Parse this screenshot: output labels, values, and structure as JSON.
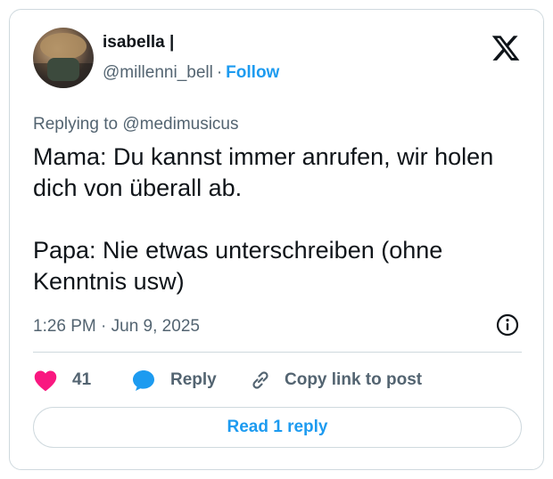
{
  "author": {
    "display_name": "isabella |",
    "handle": "@millenni_bell",
    "follow_label": "Follow",
    "separator": "·"
  },
  "reply_context": {
    "prefix": "Replying to",
    "mention": "@medimusicus"
  },
  "tweet": {
    "lines": [
      "Mama: Du kannst immer anrufen, wir holen dich von überall ab.",
      "Papa: Nie etwas unterschreiben (ohne Kenntnis usw)"
    ],
    "timestamp": "1:26 PM · Jun 9, 2025"
  },
  "actions": {
    "like_count": "41",
    "reply_label": "Reply",
    "copy_label": "Copy link to post"
  },
  "read_replies_label": "Read 1 reply",
  "colors": {
    "accent": "#1d9bf0",
    "like": "#f91880",
    "muted": "#536471",
    "border": "#cfd9de"
  },
  "icons": [
    "x-logo-icon",
    "info-icon",
    "heart-icon",
    "speech-bubble-icon",
    "link-icon"
  ]
}
